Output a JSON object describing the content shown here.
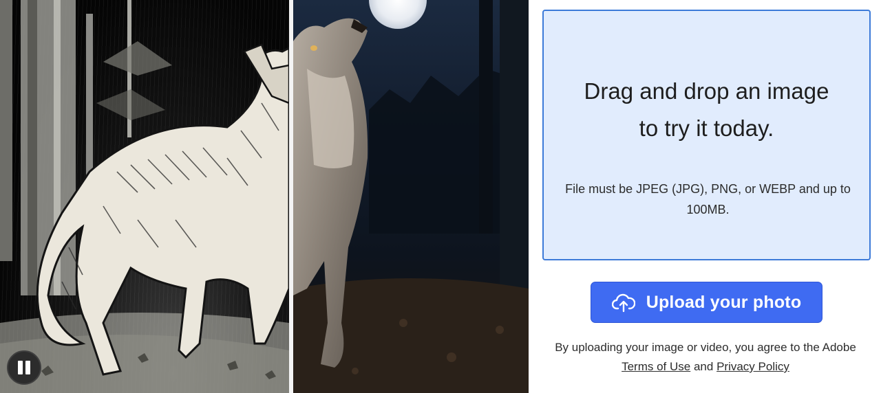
{
  "comparison": {
    "left_image": "pen-and-ink-wolf-illustration",
    "right_image": "photoreal-wolf-howling-at-moon",
    "pause_icon": "pause-icon"
  },
  "dropzone": {
    "title_line1": "Drag and drop an image",
    "title_line2": "to try it today.",
    "file_note": "File must be JPEG (JPG), PNG, or WEBP and up to 100MB."
  },
  "upload_button": {
    "label": "Upload your photo",
    "icon": "cloud-upload-icon"
  },
  "legal": {
    "prefix": "By uploading your image or video, you agree to the Adobe",
    "terms": "Terms of Use",
    "conjunction": "and",
    "privacy": "Privacy Policy"
  },
  "colors": {
    "dropzone_bg": "#e1ecfd",
    "dropzone_border": "#3c7ad8",
    "button_bg": "#3f6bf2"
  }
}
